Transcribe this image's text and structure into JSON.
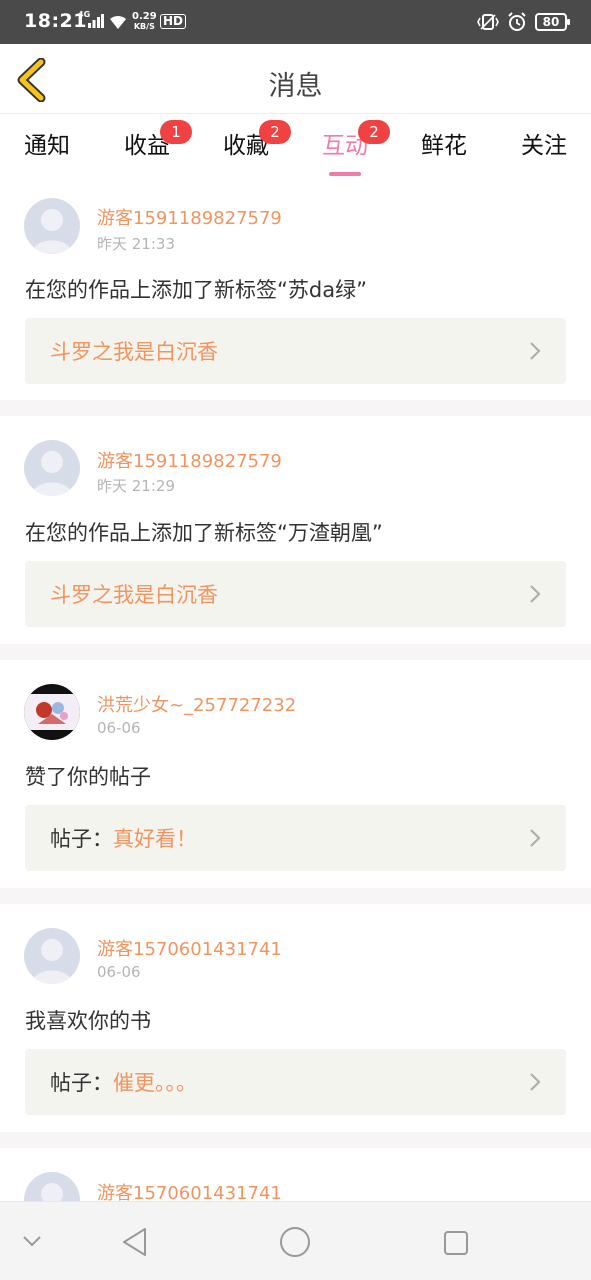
{
  "status_bar": {
    "time": "18:21",
    "network": "4G",
    "net_speed_value": "0.29",
    "net_speed_unit": "KB/S",
    "hd": "HD",
    "battery": "80",
    "icons": [
      "signal-icon",
      "wifi-icon",
      "vibrate-icon",
      "alarm-icon",
      "battery-icon"
    ]
  },
  "header": {
    "title": "消息",
    "back_icon": "chevron-left-icon",
    "accent_color": "#f5c518"
  },
  "tabs": [
    {
      "label": "通知",
      "badge": ""
    },
    {
      "label": "收益",
      "badge": "1"
    },
    {
      "label": "收藏",
      "badge": "2"
    },
    {
      "label": "互动",
      "badge": "2",
      "active": true
    },
    {
      "label": "鲜花",
      "badge": ""
    },
    {
      "label": "关注",
      "badge": ""
    }
  ],
  "colors": {
    "active_tab": "#f07aa9",
    "username": "#f0955f",
    "badge": "#f04242"
  },
  "messages": [
    {
      "user": "游客1591189827579",
      "time": "昨天 21:33",
      "text": "在您的作品上添加了新标签“苏da绿”",
      "ref_label": "",
      "ref_value": "斗罗之我是白沉香"
    },
    {
      "user": "游客1591189827579",
      "time": "昨天 21:29",
      "text": "在您的作品上添加了新标签“万渣朝凰”",
      "ref_label": "",
      "ref_value": "斗罗之我是白沉香"
    },
    {
      "user": "洪荒少女~_257727232",
      "time": "06-06",
      "text": "赞了你的帖子",
      "ref_label": "帖子：",
      "ref_value": "真好看！"
    },
    {
      "user": "游客1570601431741",
      "time": "06-06",
      "text": "我喜欢你的书",
      "ref_label": "帖子：",
      "ref_value": "催更。。。"
    },
    {
      "user": "游客1570601431741"
    }
  ],
  "nav": {
    "icons": [
      "collapse-icon",
      "back-triangle-icon",
      "home-circle-icon",
      "recents-square-icon"
    ]
  }
}
